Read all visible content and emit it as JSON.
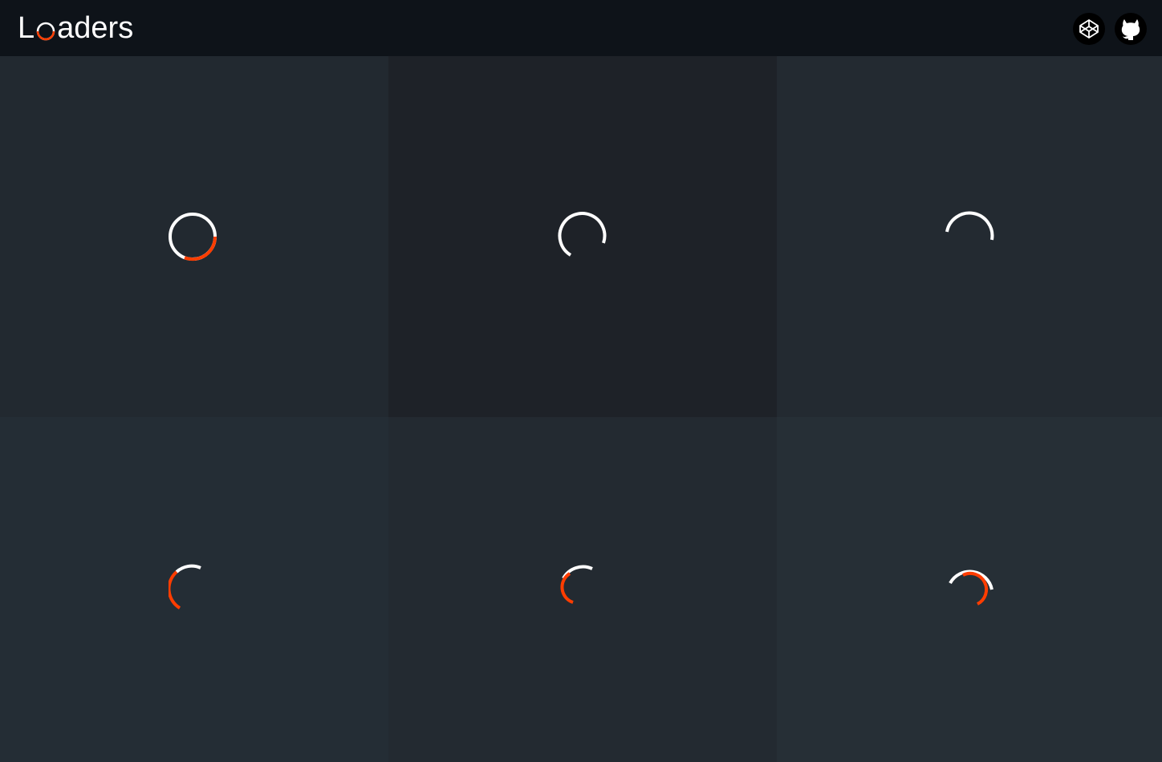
{
  "header": {
    "title_start": "L",
    "title_end": "aders",
    "codepen_icon": "codepen-icon",
    "github_icon": "github-icon"
  },
  "colors": {
    "accent": "#ff3d00",
    "ring": "#ffffff",
    "topbar": "#0e1319"
  },
  "loaders": [
    {
      "name": "loader-1"
    },
    {
      "name": "loader-2"
    },
    {
      "name": "loader-3"
    },
    {
      "name": "loader-4"
    },
    {
      "name": "loader-5"
    },
    {
      "name": "loader-6"
    }
  ]
}
